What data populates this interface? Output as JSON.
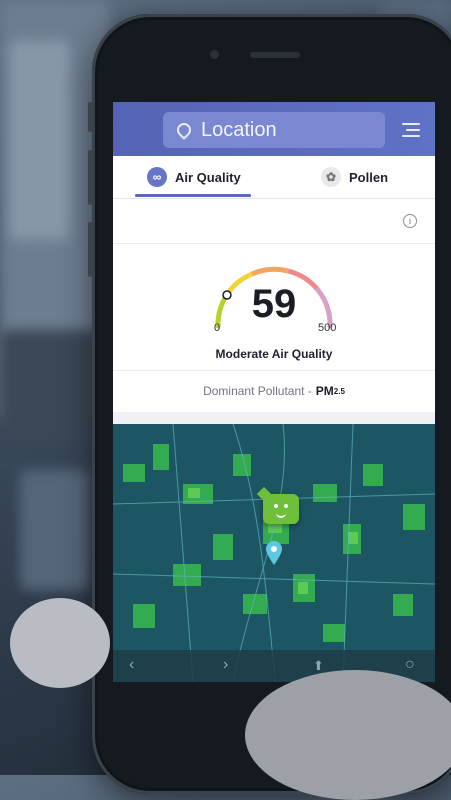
{
  "header": {
    "location_label": "Location",
    "pin_icon": "location-pin-icon",
    "menu_icon": "hamburger-menu-icon"
  },
  "tabs": [
    {
      "label": "Air Quality",
      "icon": "air-quality-icon",
      "active": true
    },
    {
      "label": "Pollen",
      "icon": "pollen-icon",
      "active": false
    }
  ],
  "info_icon": "info-icon",
  "gauge": {
    "aqi_value": "59",
    "min_label": "0",
    "max_label": "500",
    "quality_label": "Moderate Air Quality",
    "colors": [
      "#b5d330",
      "#f2d43a",
      "#f2a55f",
      "#ef8a8a",
      "#d7a0c9"
    ]
  },
  "pollutant": {
    "prefix": "Dominant Pollutant -",
    "name": "PM",
    "subscript": "2.5"
  },
  "map": {
    "marker_icon": "map-marker-icon",
    "chat_bot_icon": "chat-bot-icon",
    "water_color": "#1d5663",
    "heat_color": "#3cc84a"
  },
  "browser_bar": {
    "back_icon": "back-arrow-icon",
    "forward_icon": "forward-arrow-icon",
    "share_icon": "share-icon",
    "compass_icon": "compass-icon"
  }
}
